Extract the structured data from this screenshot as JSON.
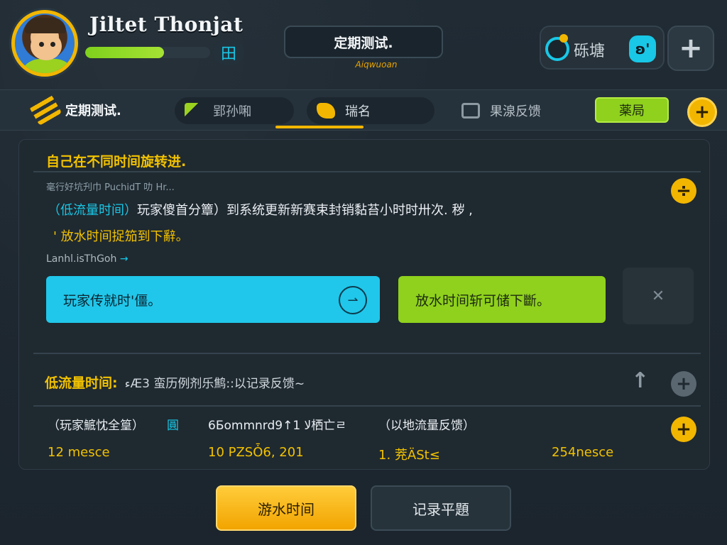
{
  "header": {
    "player_name": "Jiltet Thonjat",
    "xp_fraction": 0.63,
    "grid_symbol": "田",
    "title": "定期测试.",
    "title_sub": "Aiqwuoan",
    "currency_label": "砾塘",
    "pet_symbol": "ʚ'",
    "add_symbol": "+"
  },
  "tabs": {
    "home_label": "定期测试.",
    "tab1_label": "郢孙啝",
    "tab2_label": "瑞名",
    "tab3_label": "果湶反馈",
    "confirm_label": "薬局",
    "plus_symbol": "+"
  },
  "quest": {
    "title": "自己在不同时间旋转进.",
    "subtitle": "毫行好坑刋巾 PuchidT 叻 Hr...",
    "desc_highlight": "（低流量时间）",
    "desc_rest": "玩家傻首分簟）到系统更新新赛束封销黏苔小时时卅次. 秽 ,",
    "desc2": "' 放水时间捉笳到下辭。",
    "link_text": "Lanhl.isThGoh",
    "link_arrow": "→",
    "side_symbol": "÷",
    "btn_cyan_label": "玩家传就时'僵。",
    "btn_cyan_icon": "⇀",
    "btn_green_label": "放水时间斩可储下斷。",
    "btn_close_symbol": "✕"
  },
  "records": {
    "title": "低流量时间:",
    "title_rest": "ءÆ3 蛮历例剂乐鹪::以记录反馈~",
    "up_symbol": "↑",
    "add_symbol": "+",
    "columns": [
      "（玩家鯳忱全篁）",
      "6Бommnrd9↑1 ﻻ栖亡ㄹ",
      "（以地流量反馈）"
    ],
    "column_extra": "圓",
    "row_values": [
      "12 mesc‍e",
      "10 PZSȰ6, 201",
      "1. 茺ÄSt≤",
      "254nesce"
    ],
    "row_add_symbol": "+"
  },
  "bottom": {
    "play_label": "游水时间",
    "record_label": "记录平題"
  },
  "colors": {
    "accent_yellow": "#f2b600",
    "accent_cyan": "#20c7ea",
    "accent_green": "#8fd11d",
    "background": "#1f2a33"
  }
}
